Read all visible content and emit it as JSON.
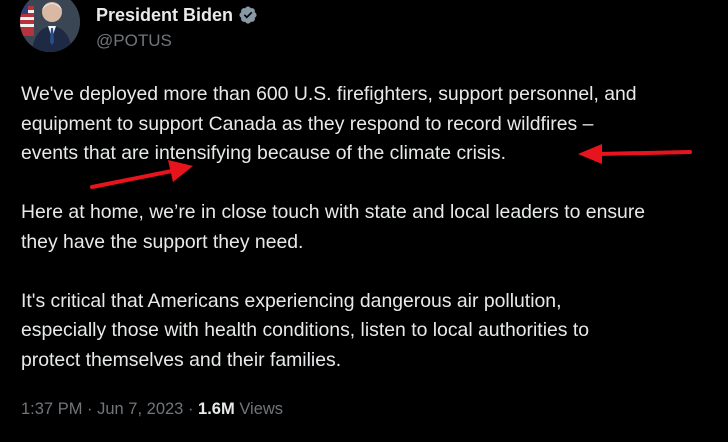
{
  "author": {
    "display_name": "President Biden",
    "handle": "@POTUS",
    "verified": true,
    "verified_color": "#8899a6"
  },
  "tweet": {
    "paragraphs": [
      "We've deployed more than 600 U.S. firefighters, support personnel, and\nequipment to support Canada as they respond to record wildfires –\nevents that are intensifying because of the climate crisis.",
      "Here at home, we’re in close touch with state and local leaders to ensure\nthey have the support they need.",
      "It's critical that Americans experiencing dangerous air pollution,\nespecially those with health conditions, listen to local authorities to\nprotect themselves and their families."
    ],
    "time": "1:37 PM",
    "separator": " · ",
    "date": "Jun 7, 2023",
    "views_count": "1.6M",
    "views_label": " Views"
  },
  "colors": {
    "background": "#000000",
    "text": "#e7e9ea",
    "secondary": "#71767b",
    "annotation_arrow": "#e8141d"
  },
  "annotations": {
    "icon": "red-arrow-icon",
    "count": 2
  }
}
